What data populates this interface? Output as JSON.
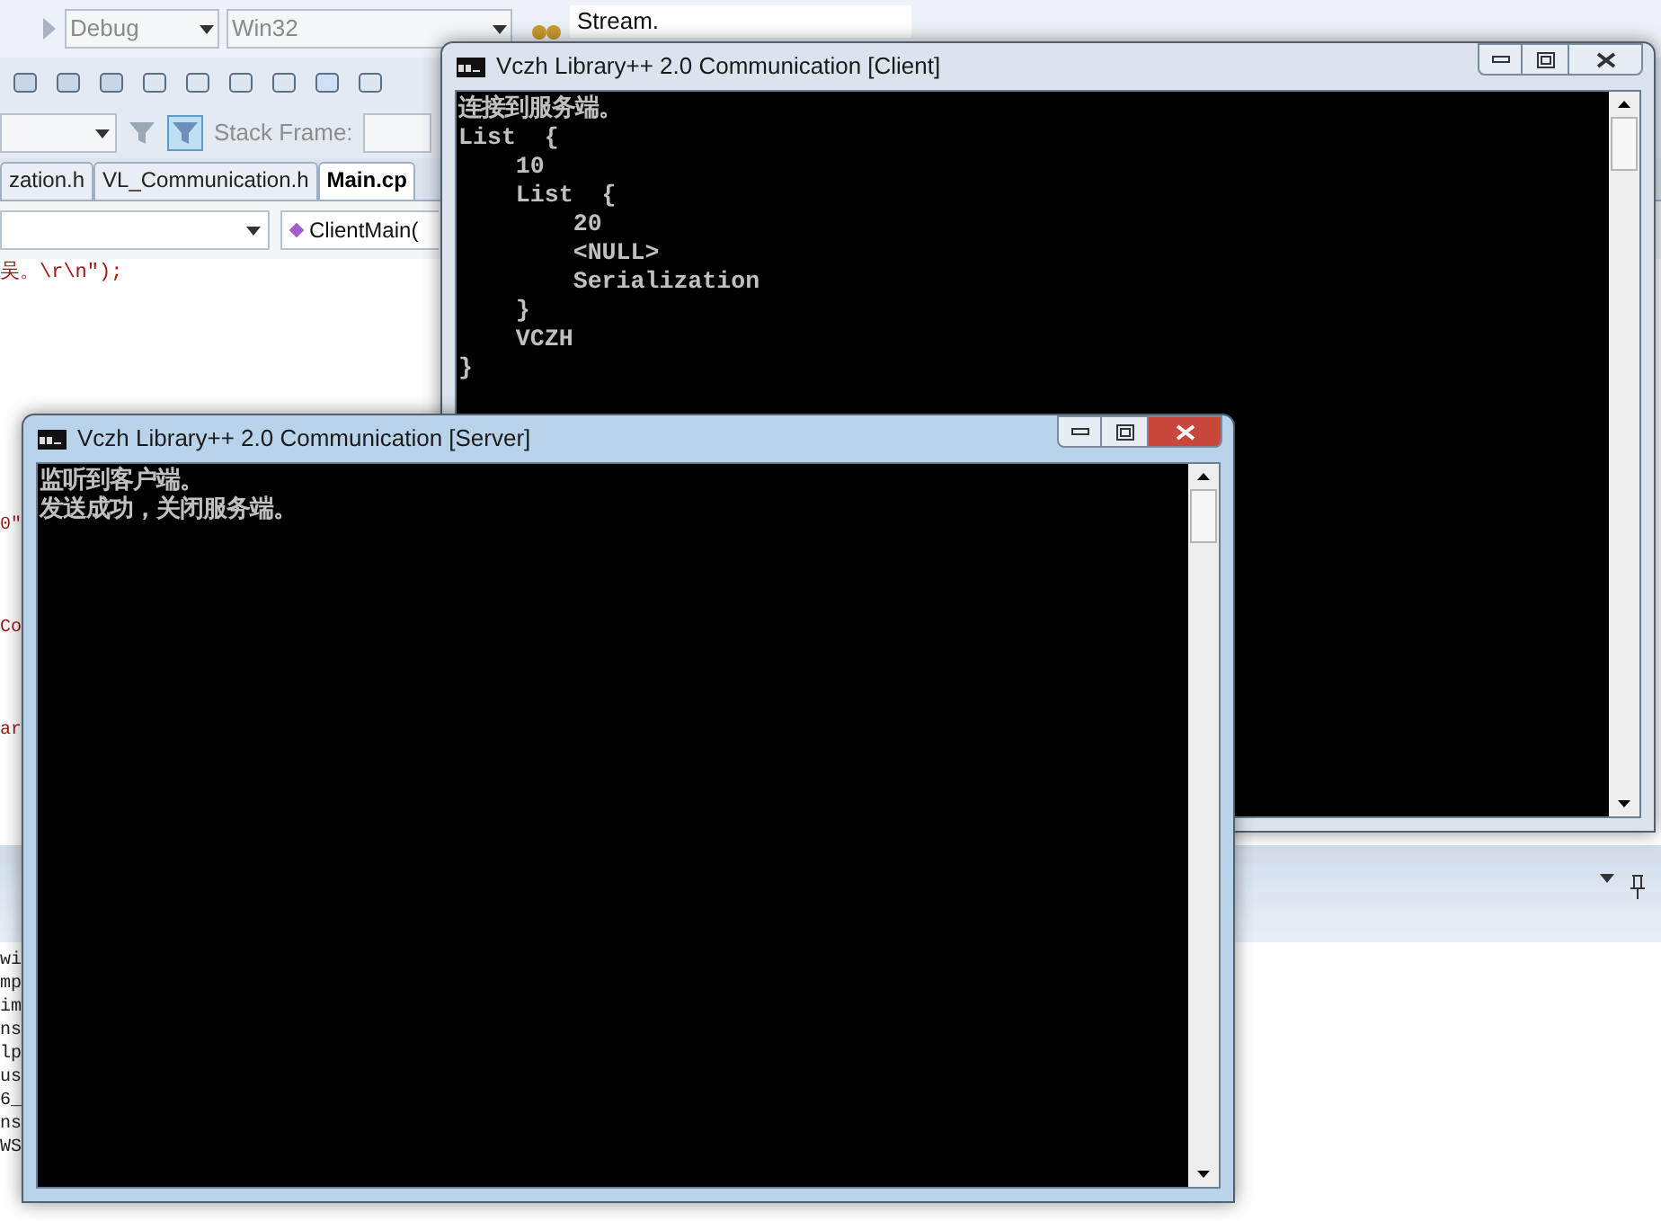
{
  "ide": {
    "toolbar": {
      "configuration": "Debug",
      "platform": "Win32",
      "find": "Stream."
    },
    "debug_bar": {
      "stack_frame_label": "Stack Frame:"
    },
    "tabs": [
      {
        "label": "zation.h",
        "selected": false
      },
      {
        "label": "VL_Communication.h",
        "selected": false
      },
      {
        "label": "Main.cp",
        "selected": true
      }
    ],
    "function_dropdown": "ClientMain(",
    "code_line": "吴。\\r\\n\");",
    "code_fragments": [
      "0\"",
      "Co",
      "ar"
    ],
    "output_lines": [
      "wi",
      "mp",
      "im",
      "ns",
      "lp",
      "us",
      "6_",
      "ns",
      "WS"
    ]
  },
  "windows": [
    {
      "title": "Vczh Library++ 2.0 Communication [Client]",
      "active": false,
      "lines": [
        "连接到服务端。",
        "List  {",
        "    10",
        "    List  {",
        "        20",
        "        <NULL>",
        "        Serialization",
        "    }",
        "    VCZH",
        "}"
      ]
    },
    {
      "title": "Vczh Library++ 2.0 Communication [Server]",
      "active": true,
      "lines": [
        "监听到客户端。",
        "发送成功，关闭服务端。"
      ]
    }
  ]
}
